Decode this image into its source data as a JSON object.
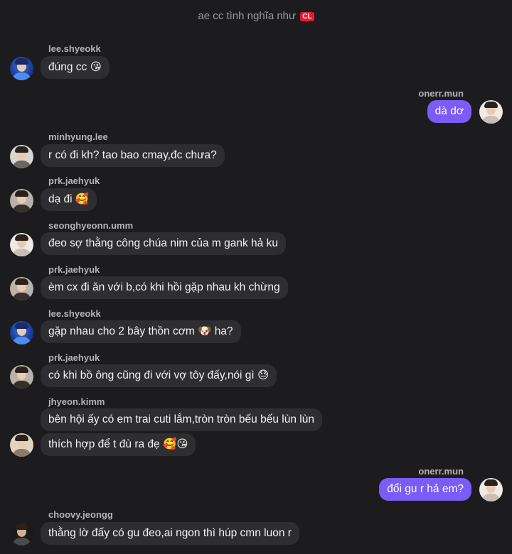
{
  "header": {
    "title": "ae cc tình nghĩa như",
    "badge": "CL"
  },
  "messages": [
    {
      "sender": "lee.shyeokk",
      "text": "đúng cc 😘",
      "direction": "in",
      "avatar": "avatar-lee-shyeokk"
    },
    {
      "sender": "onerr.mun",
      "text": "dà dơ",
      "direction": "out",
      "avatar": "avatar-onerr-mun"
    },
    {
      "sender": "minhyung.lee",
      "text": "r có đi kh? tao bao cmay,đc chưa?",
      "direction": "in",
      "avatar": "avatar-minhyung-lee"
    },
    {
      "sender": "prk.jaehyuk",
      "text": "dạ đi 🥰",
      "direction": "in",
      "avatar": "avatar-prk-jaehyuk"
    },
    {
      "sender": "seonghyeonn.umm",
      "text": "đeo sợ thằng công chúa nim của m gank hả ku",
      "direction": "in",
      "avatar": "avatar-seonghyeonn-umm"
    },
    {
      "sender": "prk.jaehyuk",
      "text": "èm cx đi ăn với b,có khi hồi gặp nhau kh chừng",
      "direction": "in",
      "avatar": "avatar-prk-jaehyuk"
    },
    {
      "sender": "lee.shyeokk",
      "text": "gặp nhau cho 2 bây thồn cơm 🐶 ha?",
      "direction": "in",
      "avatar": "avatar-lee-shyeokk"
    },
    {
      "sender": "prk.jaehyuk",
      "text": "có khi bồ ông cũng đi với vợ tôy đấy,nói gì 😓",
      "direction": "in",
      "avatar": "avatar-prk-jaehyuk"
    },
    {
      "sender": "jhyeon.kimm",
      "text": "bên hội ấy có em trai cuti lắm,tròn tròn bếu bếu lùn lùn",
      "direction": "in",
      "avatar": "avatar-jhyeon-kimm"
    },
    {
      "sender": "",
      "text": "thích hợp để t đù ra đẹ 🥰😘",
      "direction": "in",
      "avatar": ""
    },
    {
      "sender": "onerr.mun",
      "text": "đổi gu r hả em?",
      "direction": "out",
      "avatar": "avatar-onerr-mun"
    },
    {
      "sender": "choovy.jeongg",
      "text": "thằng lờ đấy có gu đeo,ai ngon thì húp cmn luon r",
      "direction": "in",
      "avatar": "avatar-choovy-jeongg"
    }
  ]
}
